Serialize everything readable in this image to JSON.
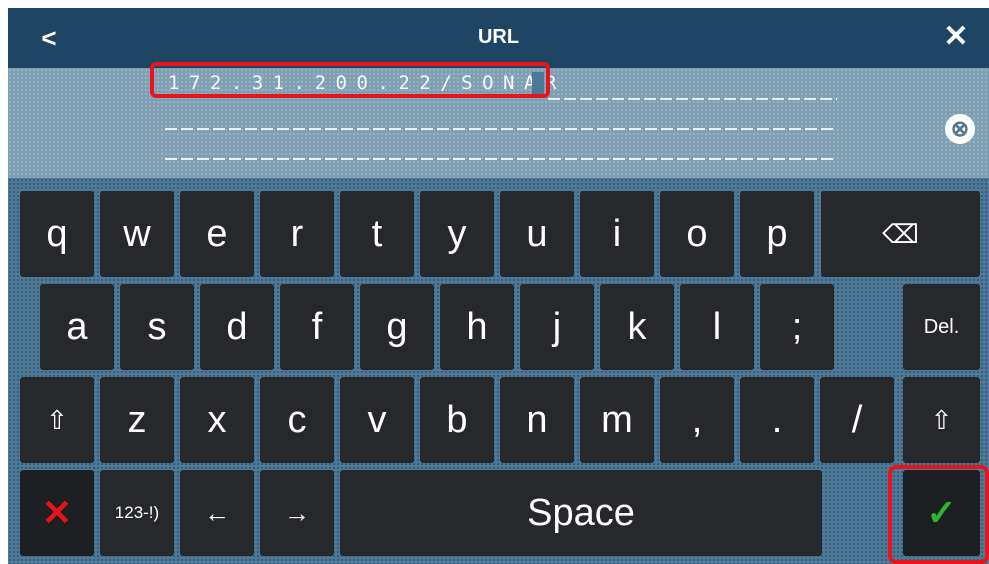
{
  "header": {
    "title": "URL",
    "back_label": "<",
    "close_label": "✕"
  },
  "input": {
    "value": "172.31.200.22/SONAR",
    "clear_label": "⊗"
  },
  "keyboard": {
    "row1": [
      "q",
      "w",
      "e",
      "r",
      "t",
      "y",
      "u",
      "i",
      "o",
      "p"
    ],
    "backspace_label": "⌫",
    "row2": [
      "a",
      "s",
      "d",
      "f",
      "g",
      "h",
      "j",
      "k",
      "l",
      ";"
    ],
    "del_label": "Del.",
    "shift_label": "⇧",
    "row3": [
      "z",
      "x",
      "c",
      "v",
      "b",
      "n",
      "m",
      ",",
      ".",
      "/"
    ],
    "cancel_label": "✕",
    "symbols_label": "123-!)",
    "left_arrow_label": "←",
    "right_arrow_label": "→",
    "space_label": "Space",
    "confirm_label": "✓"
  },
  "colors": {
    "cancel": "#e8141c",
    "confirm": "#2fb52f",
    "highlight": "#e8141c"
  }
}
